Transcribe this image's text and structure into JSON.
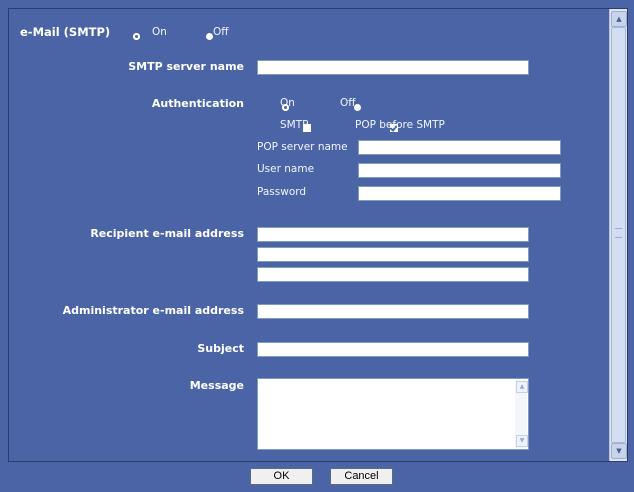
{
  "smtp": {
    "title": "e-Mail (SMTP)",
    "on_label": "On",
    "off_label": "Off",
    "state": "On"
  },
  "fields": {
    "smtp_server_label": "SMTP server name",
    "authentication_label": "Authentication",
    "auth_on_label": "On",
    "auth_off_label": "Off",
    "auth_state": "On",
    "smtp_checkbox_label": "SMTP",
    "smtp_checkbox_checked": false,
    "pop_checkbox_label": "POP before SMTP",
    "pop_checkbox_checked": true,
    "pop_server_label": "POP server name",
    "user_name_label": "User name",
    "password_label": "Password",
    "recipient_label": "Recipient e-mail address",
    "administrator_label": "Administrator e-mail address",
    "subject_label": "Subject",
    "message_label": "Message"
  },
  "buttons": {
    "ok": "OK",
    "cancel": "Cancel"
  },
  "colors": {
    "background": "#4a64a6",
    "text": "#ffffff"
  }
}
